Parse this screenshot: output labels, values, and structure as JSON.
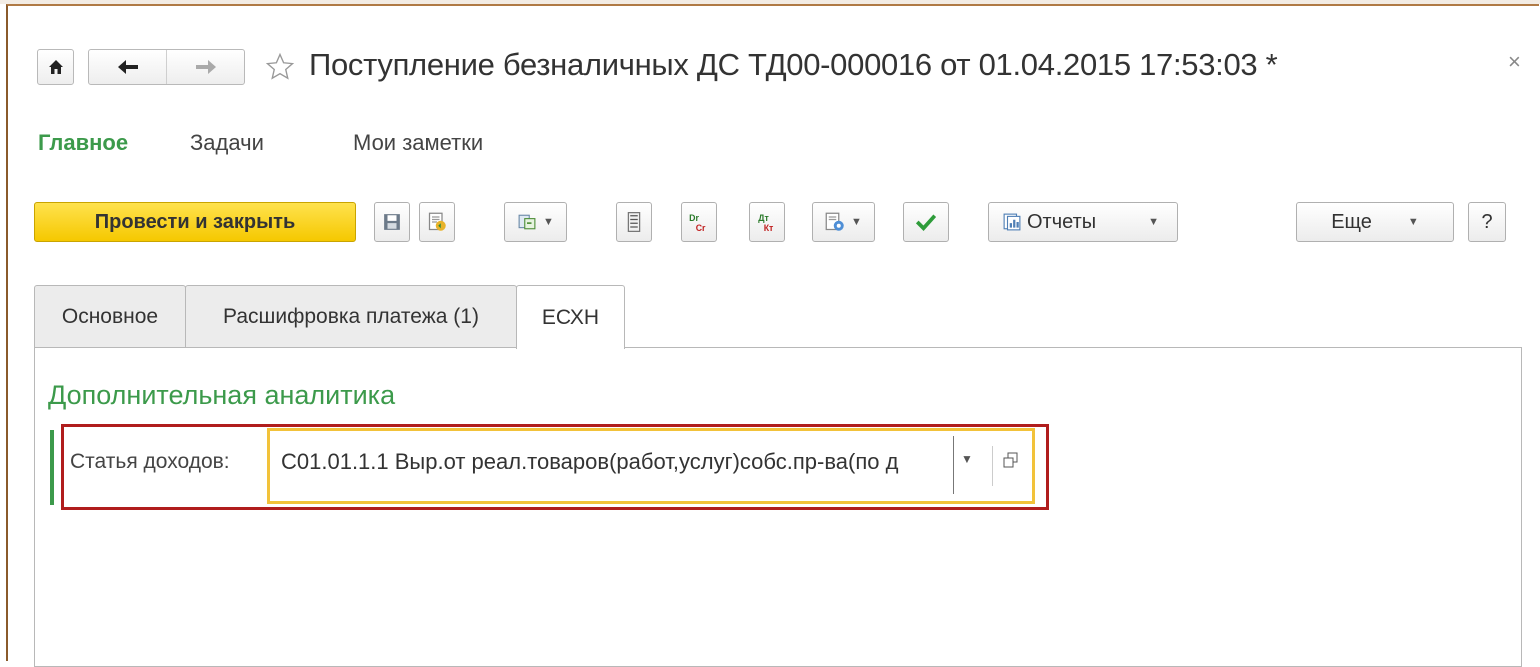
{
  "window": {
    "title": "Поступление безналичных ДС ТД00-000016 от 01.04.2015 17:53:03 *",
    "close_glyph": "×"
  },
  "nav": {
    "home_icon": "home-icon",
    "back_icon": "arrow-left-icon",
    "forward_icon": "arrow-right-icon",
    "favorite_icon": "star-outline-icon"
  },
  "sections": {
    "main": "Главное",
    "tasks": "Задачи",
    "notes": "Мои заметки"
  },
  "toolbar": {
    "post_and_close": "Провести и закрыть",
    "reports": "Отчеты",
    "more": "Еще",
    "help": "?",
    "accent_color": "#f5c800"
  },
  "tabs": [
    {
      "label": "Основное",
      "active": false
    },
    {
      "label": "Расшифровка платежа (1)",
      "active": false
    },
    {
      "label": "ЕСХН",
      "active": true
    }
  ],
  "form": {
    "group_title": "Дополнительная аналитика",
    "income_item": {
      "label": "Статья доходов:",
      "value": "С01.01.1.1 Выр.от реал.товаров(работ,услуг)собс.пр-ва(по д"
    }
  },
  "colors": {
    "section_active": "#3c9a4b",
    "highlight_outer": "#b01d1d",
    "highlight_inner": "#f2c23a"
  }
}
